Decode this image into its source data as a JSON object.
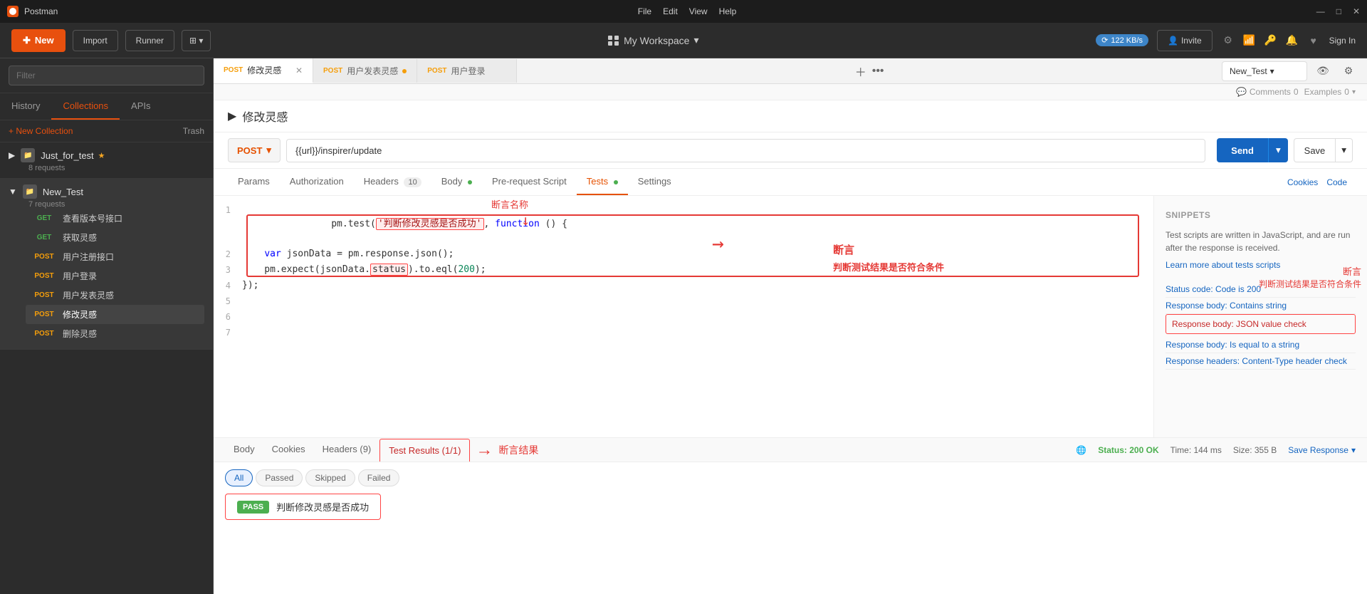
{
  "app": {
    "title": "Postman",
    "icon": "P"
  },
  "titlebar": {
    "menus": [
      "File",
      "Edit",
      "View",
      "Help"
    ],
    "controls": [
      "—",
      "□",
      "✕"
    ]
  },
  "toolbar": {
    "new_label": "New",
    "import_label": "Import",
    "runner_label": "Runner",
    "workspace_label": "My Workspace",
    "invite_label": "Invite",
    "sign_in_label": "Sign In",
    "network_speed": "122 KB/s"
  },
  "sidebar": {
    "search_placeholder": "Filter",
    "tabs": [
      "History",
      "Collections",
      "APIs"
    ],
    "active_tab": "Collections",
    "new_collection_label": "+ New Collection",
    "trash_label": "Trash",
    "collections": [
      {
        "name": "Just_for_test",
        "star": true,
        "requests_count": "8 requests",
        "expanded": false
      },
      {
        "name": "New_Test",
        "star": false,
        "requests_count": "7 requests",
        "expanded": true,
        "requests": [
          {
            "method": "GET",
            "name": "查看版本号接口"
          },
          {
            "method": "GET",
            "name": "获取灵感"
          },
          {
            "method": "POST",
            "name": "用户注册接口"
          },
          {
            "method": "POST",
            "name": "用户登录"
          },
          {
            "method": "POST",
            "name": "用户发表灵感"
          },
          {
            "method": "POST",
            "name": "修改灵感",
            "active": true
          },
          {
            "method": "POST",
            "name": "删除灵感"
          }
        ]
      }
    ]
  },
  "tabs": [
    {
      "method": "POST",
      "name": "修改灵感",
      "active": true,
      "closeable": true
    },
    {
      "method": "POST",
      "name": "用户发表灵感",
      "dot": true
    },
    {
      "method": "POST",
      "name": "用户登录"
    }
  ],
  "request": {
    "title": "修改灵感",
    "method": "POST",
    "url": "{{url}}/inspirer/update",
    "save_label": "Save",
    "send_label": "Send"
  },
  "request_tabs": {
    "tabs": [
      {
        "label": "Params",
        "active": false
      },
      {
        "label": "Authorization",
        "active": false
      },
      {
        "label": "Headers",
        "active": false,
        "badge": "10"
      },
      {
        "label": "Body",
        "active": false,
        "dot": true
      },
      {
        "label": "Pre-request Script",
        "active": false
      },
      {
        "label": "Tests",
        "active": true,
        "dot": true
      },
      {
        "label": "Settings",
        "active": false
      }
    ]
  },
  "code_lines": [
    {
      "num": 1,
      "content_parts": [
        {
          "text": "pm.test(",
          "class": ""
        },
        {
          "text": "'判断修改灵感是否成功'",
          "class": "code-string code-highlight"
        },
        {
          "text": ", ",
          "class": ""
        },
        {
          "text": "function",
          "class": "code-keyword"
        },
        {
          "text": " () {",
          "class": ""
        }
      ]
    },
    {
      "num": 2,
      "content": "    var jsonData = pm.response.json();"
    },
    {
      "num": 3,
      "content_parts": [
        {
          "text": "    pm.expect(jsonData.",
          "class": ""
        },
        {
          "text": "status",
          "class": "code-highlight2"
        },
        {
          "text": ").to.eql(200);",
          "class": ""
        }
      ]
    },
    {
      "num": 4,
      "content": "});"
    },
    {
      "num": 5,
      "content": ""
    },
    {
      "num": 6,
      "content": ""
    },
    {
      "num": 7,
      "content": ""
    }
  ],
  "snippets": {
    "title": "SNIPPETS",
    "info": "Test scripts are written in JavaScript, and are run after the response is received.",
    "link": "Learn more about tests scripts",
    "items": [
      {
        "label": "Status code: Code is 200"
      },
      {
        "label": "Response body: Contains string"
      },
      {
        "label": "Response body: JSON value check",
        "highlighted": true
      },
      {
        "label": "Response body: Is equal to a string"
      },
      {
        "label": "Response headers: Content-Type header check"
      }
    ]
  },
  "response": {
    "tabs": [
      "Body",
      "Cookies",
      "Headers (9)",
      "Test Results (1/1)"
    ],
    "active_tab": "Test Results (1/1)",
    "status": "200 OK",
    "time": "144 ms",
    "size": "355 B",
    "save_response_label": "Save Response"
  },
  "test_results": {
    "filter_tabs": [
      "All",
      "Passed",
      "Skipped",
      "Failed"
    ],
    "active_filter": "All",
    "results": [
      {
        "status": "PASS",
        "name": "判断修改灵感是否成功"
      }
    ]
  },
  "annotations": {
    "assertion_name_label": "断言名称",
    "assertion_label": "断言",
    "assertion_check_label": "判断测试结果是否符合条件",
    "assertion_result_label": "断言结果"
  },
  "env_dropdown": {
    "label": "New_Test"
  },
  "top_right": {
    "comments_label": "Comments",
    "comments_count": "0",
    "examples_label": "Examples",
    "examples_count": "0"
  }
}
